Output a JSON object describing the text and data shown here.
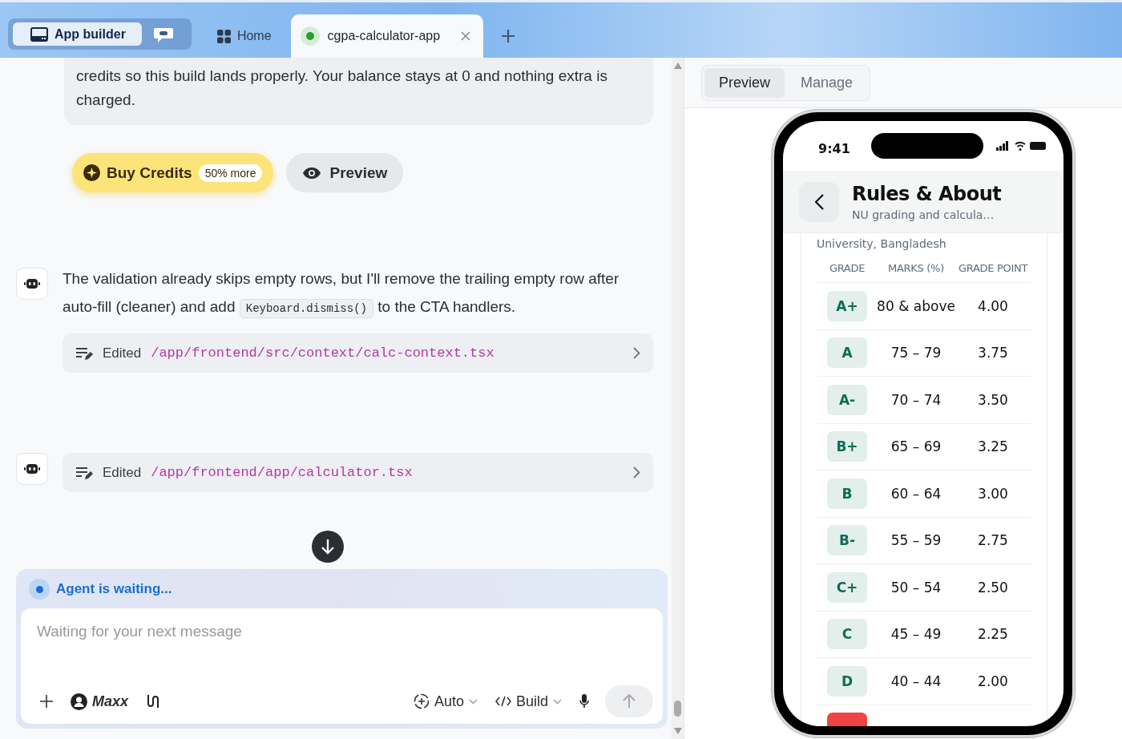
{
  "tabbar": {
    "app_switch": {
      "label": "App builder",
      "selected": true
    },
    "tabs": [
      {
        "label": "Home",
        "selected": false,
        "kind": "home"
      },
      {
        "label": "cgpa-calculator-app",
        "selected": true,
        "kind": "project"
      }
    ]
  },
  "chat": {
    "notice": "credits so this build lands properly. Your balance stays at 0 and nothing extra is charged.",
    "buy_button": {
      "label": "Buy Credits",
      "badge": "50% more"
    },
    "preview_button": "Preview",
    "messages": [
      {
        "parts": [
          {
            "kind": "text",
            "text": "The validation already skips empty rows, but I'll remove the trailing empty row after auto-fill (cleaner) and add "
          },
          {
            "kind": "code",
            "text": "Keyboard.dismiss()"
          },
          {
            "kind": "text",
            "text": " to the CTA handlers."
          }
        ],
        "edits": [
          {
            "label": "Edited",
            "path": "/app/frontend/src/context/calc-context.tsx"
          }
        ]
      },
      {
        "edits": [
          {
            "label": "Edited",
            "path": "/app/frontend/app/calculator.tsx"
          }
        ]
      }
    ]
  },
  "composer": {
    "status": "Agent is waiting...",
    "placeholder": "Waiting for your next message",
    "agent": "Maxx",
    "mode": "Auto",
    "build": "Build"
  },
  "preview": {
    "tabs": [
      {
        "label": "Preview",
        "selected": true
      },
      {
        "label": "Manage",
        "selected": false
      }
    ],
    "phone": {
      "time": "9:41",
      "title": "Rules & About",
      "subtitle": "NU grading and calcula…",
      "intro": "University, Bangladesh",
      "columns": [
        "GRADE",
        "MARKS (%)",
        "GRADE POINT"
      ],
      "rows": [
        {
          "grade": "A+",
          "marks": "80 & above",
          "point": "4.00",
          "kind": "pass"
        },
        {
          "grade": "A",
          "marks": "75 – 79",
          "point": "3.75",
          "kind": "pass"
        },
        {
          "grade": "A-",
          "marks": "70 – 74",
          "point": "3.50",
          "kind": "pass"
        },
        {
          "grade": "B+",
          "marks": "65 – 69",
          "point": "3.25",
          "kind": "pass"
        },
        {
          "grade": "B",
          "marks": "60 – 64",
          "point": "3.00",
          "kind": "pass"
        },
        {
          "grade": "B-",
          "marks": "55 – 59",
          "point": "2.75",
          "kind": "pass"
        },
        {
          "grade": "C+",
          "marks": "50 – 54",
          "point": "2.50",
          "kind": "pass"
        },
        {
          "grade": "C",
          "marks": "45 – 49",
          "point": "2.25",
          "kind": "pass"
        },
        {
          "grade": "D",
          "marks": "40 – 44",
          "point": "2.00",
          "kind": "pass"
        },
        {
          "kind": "fail"
        }
      ]
    }
  }
}
